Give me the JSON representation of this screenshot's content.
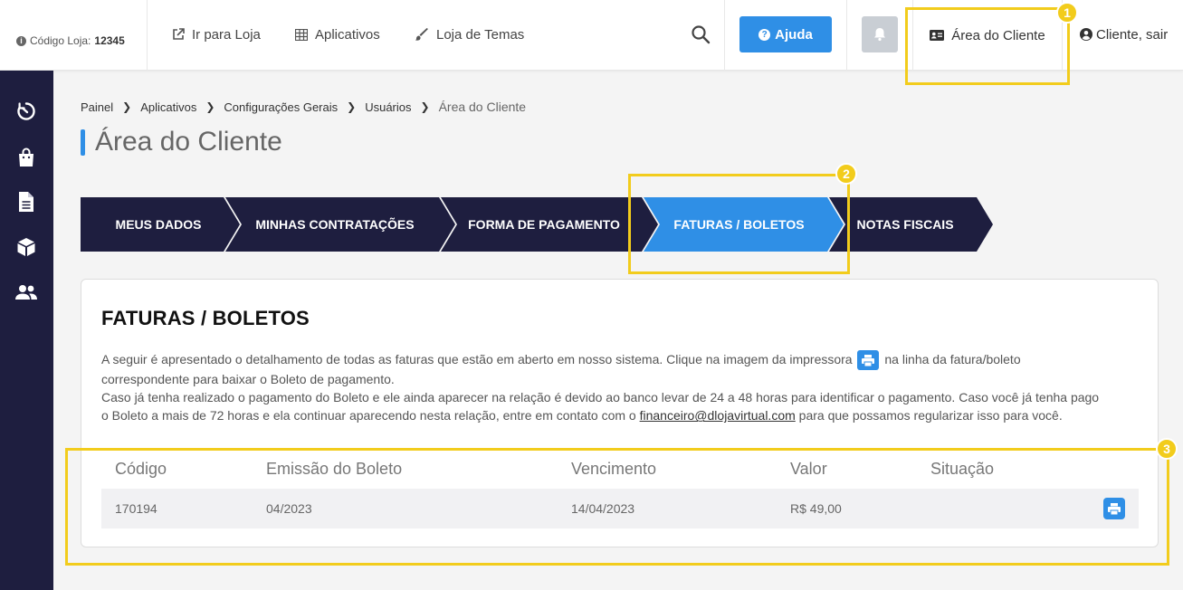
{
  "header": {
    "store_code_label": "Código Loja:",
    "store_code": "12345",
    "nav": [
      {
        "label": "Ir para Loja",
        "icon": "external-link-icon"
      },
      {
        "label": "Aplicativos",
        "icon": "grid-icon"
      },
      {
        "label": "Loja de Temas",
        "icon": "brush-icon"
      }
    ],
    "help_label": "Ajuda",
    "client_area_label": "Área do Cliente",
    "logout_label": "Cliente, sair"
  },
  "sidebar": {
    "icons": [
      "dashboard-icon",
      "shopping-bag-icon",
      "document-icon",
      "box-icon",
      "users-icon"
    ]
  },
  "breadcrumb": [
    "Painel",
    "Aplicativos",
    "Configurações Gerais",
    "Usuários",
    "Área do Cliente"
  ],
  "page_title": "Área do Cliente",
  "steps": [
    {
      "label": "MEUS DADOS",
      "active": false
    },
    {
      "label": "MINHAS CONTRATAÇÕES",
      "active": false
    },
    {
      "label": "FORMA DE PAGAMENTO",
      "active": false
    },
    {
      "label": "FATURAS / BOLETOS",
      "active": true
    },
    {
      "label": "NOTAS FISCAIS",
      "active": false
    }
  ],
  "card": {
    "title": "FATURAS / BOLETOS",
    "desc_1a": "A seguir é apresentado o detalhamento de todas as faturas que estão em aberto em nosso sistema. Clique na imagem da impressora",
    "desc_1b": "na linha da fatura/boleto correspondente para baixar o Boleto de pagamento.",
    "desc_2a": "Caso já tenha realizado o pagamento do Boleto e ele ainda aparecer na relação é devido ao banco levar de 24 a 48 horas para identificar o pagamento. Caso você já tenha pago o Boleto a mais de 72 horas e ela continuar aparecendo nesta relação, entre em contato com o",
    "email": "financeiro@dlojavirtual.com",
    "desc_2b": "para que possamos regularizar isso para você.",
    "columns": [
      "Código",
      "Emissão do Boleto",
      "Vencimento",
      "Valor",
      "Situação"
    ],
    "rows": [
      {
        "codigo": "170194",
        "emissao": "04/2023",
        "vencimento": "14/04/2023",
        "valor": "R$ 49,00",
        "situacao": ""
      }
    ]
  },
  "annotations": [
    "1",
    "2",
    "3"
  ],
  "colors": {
    "brand_blue": "#2f8fe6",
    "navy": "#1e1e3f",
    "highlight": "#f2cc1c"
  }
}
